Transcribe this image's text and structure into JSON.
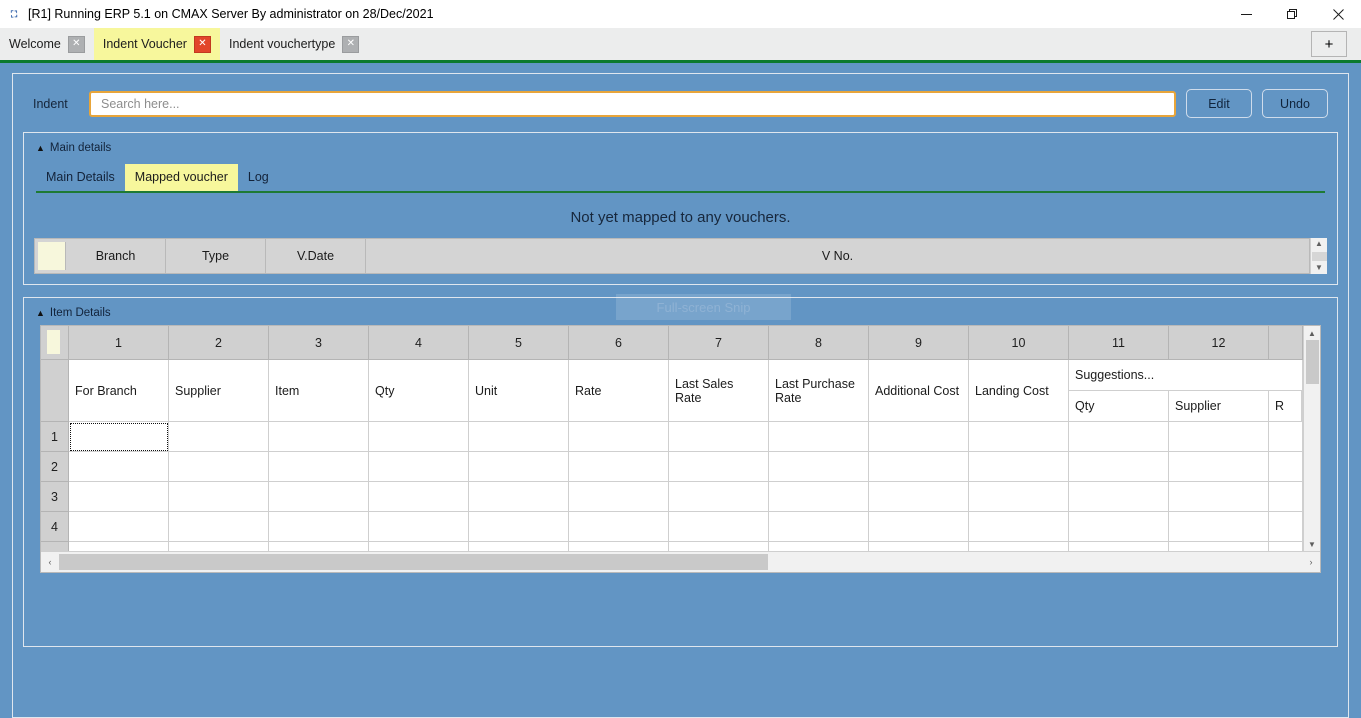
{
  "window": {
    "icon": "app-icon",
    "title": "[R1] Running ERP 5.1 on CMAX Server By administrator on 28/Dec/2021",
    "minimize_label": "minimize-icon",
    "restore_label": "restore-icon",
    "close_label": "close-icon"
  },
  "tabs": {
    "items": [
      {
        "label": "Welcome",
        "active": false,
        "close": "✕"
      },
      {
        "label": "Indent Voucher",
        "active": true,
        "close": "✕"
      },
      {
        "label": "Indent vouchertype",
        "active": false,
        "close": "✕"
      }
    ],
    "add_label": "+"
  },
  "indent_bar": {
    "label": "Indent",
    "search_value": "",
    "search_placeholder": "Search here...",
    "edit_label": "Edit",
    "undo_label": "Undo"
  },
  "main_details": {
    "group_title": "Main details",
    "collapse_glyph": "▲",
    "tabs": [
      {
        "label": "Main Details",
        "active": false
      },
      {
        "label": "Mapped voucher",
        "active": true
      },
      {
        "label": "Log",
        "active": false
      }
    ],
    "empty_note": "Not yet mapped to any vouchers.",
    "columns": [
      "Branch",
      "Type",
      "V.Date",
      "V No."
    ],
    "rows": [],
    "scroll_up": "▲",
    "scroll_down": "▼"
  },
  "item_details": {
    "group_title": "Item Details",
    "collapse_glyph": "▲",
    "snip_overlay_label": "Full-screen Snip",
    "column_numbers": [
      "1",
      "2",
      "3",
      "4",
      "5",
      "6",
      "7",
      "8",
      "9",
      "10",
      "11",
      "12"
    ],
    "field_names": [
      "For Branch",
      "Supplier",
      "Item",
      "Qty",
      "Unit",
      "Rate",
      "Last Sales Rate",
      "Last Purchase Rate",
      "Additional Cost",
      "Landing Cost"
    ],
    "suggestions": {
      "title": "Suggestions...",
      "sub_columns": [
        "Qty",
        "Supplier",
        "R"
      ]
    },
    "row_numbers": [
      "1",
      "2",
      "3",
      "4"
    ],
    "selected_cell": {
      "row": 1,
      "column": 1
    },
    "scroll_up": "▲",
    "scroll_down": "▼",
    "scroll_left": "‹",
    "scroll_right": "›"
  },
  "colors": {
    "background_blue": "#6295c4",
    "active_tab_yellow": "#f7f79c",
    "green_underline": "#0c7a2d",
    "close_red": "#e2452a",
    "focus_orange": "#e8a53a"
  }
}
